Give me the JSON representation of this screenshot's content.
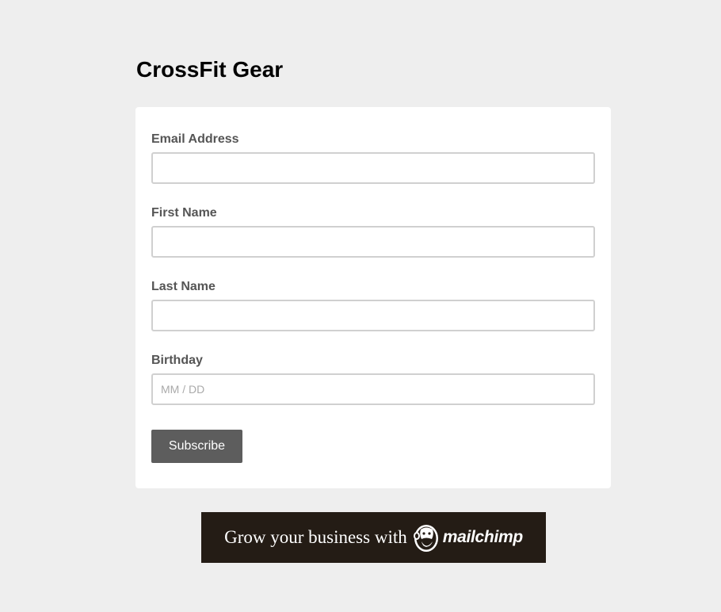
{
  "form": {
    "title": "CrossFit Gear",
    "fields": [
      {
        "label": "Email Address",
        "value": "",
        "placeholder": ""
      },
      {
        "label": "First Name",
        "value": "",
        "placeholder": ""
      },
      {
        "label": "Last Name",
        "value": "",
        "placeholder": ""
      },
      {
        "label": "Birthday",
        "value": "",
        "placeholder": "MM / DD"
      }
    ],
    "submit_label": "Subscribe"
  },
  "banner": {
    "text": "Grow your business with",
    "brand": "mailchimp",
    "icon": "mailchimp-freddie-icon"
  },
  "colors": {
    "page_background": "#eeeeee",
    "card_background": "#ffffff",
    "button_background": "#5d5d5d",
    "banner_background": "#241c15"
  }
}
